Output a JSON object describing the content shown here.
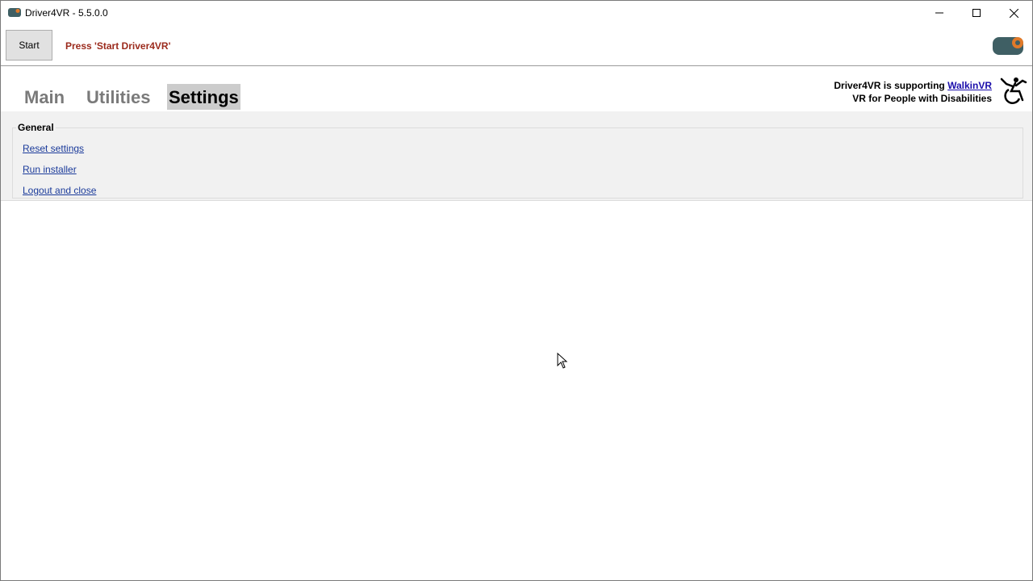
{
  "window": {
    "title": "Driver4VR - 5.5.0.0",
    "controls": {
      "minimize": "minimize-icon",
      "maximize": "maximize-icon",
      "close": "close-icon"
    }
  },
  "toolbar": {
    "start_label": "Start",
    "status_text": "Press 'Start Driver4VR'",
    "status_color": "#9b2a1c",
    "logo_icon": "driver4vr-logo-icon"
  },
  "tabs": [
    {
      "label": "Main",
      "active": false
    },
    {
      "label": "Utilities",
      "active": false
    },
    {
      "label": "Settings",
      "active": true
    }
  ],
  "support": {
    "prefix": "Driver4VR is supporting ",
    "link": "WalkinVR",
    "line2": "VR for People with Disabilities",
    "icon": "wheelchair-icon"
  },
  "settings": {
    "group_title": "General",
    "links": [
      "Reset settings",
      "Run installer",
      "Logout and close"
    ]
  },
  "colors": {
    "link": "#1a3a9a",
    "accent": "#e07a2a",
    "logo_body": "#3f5f64"
  }
}
